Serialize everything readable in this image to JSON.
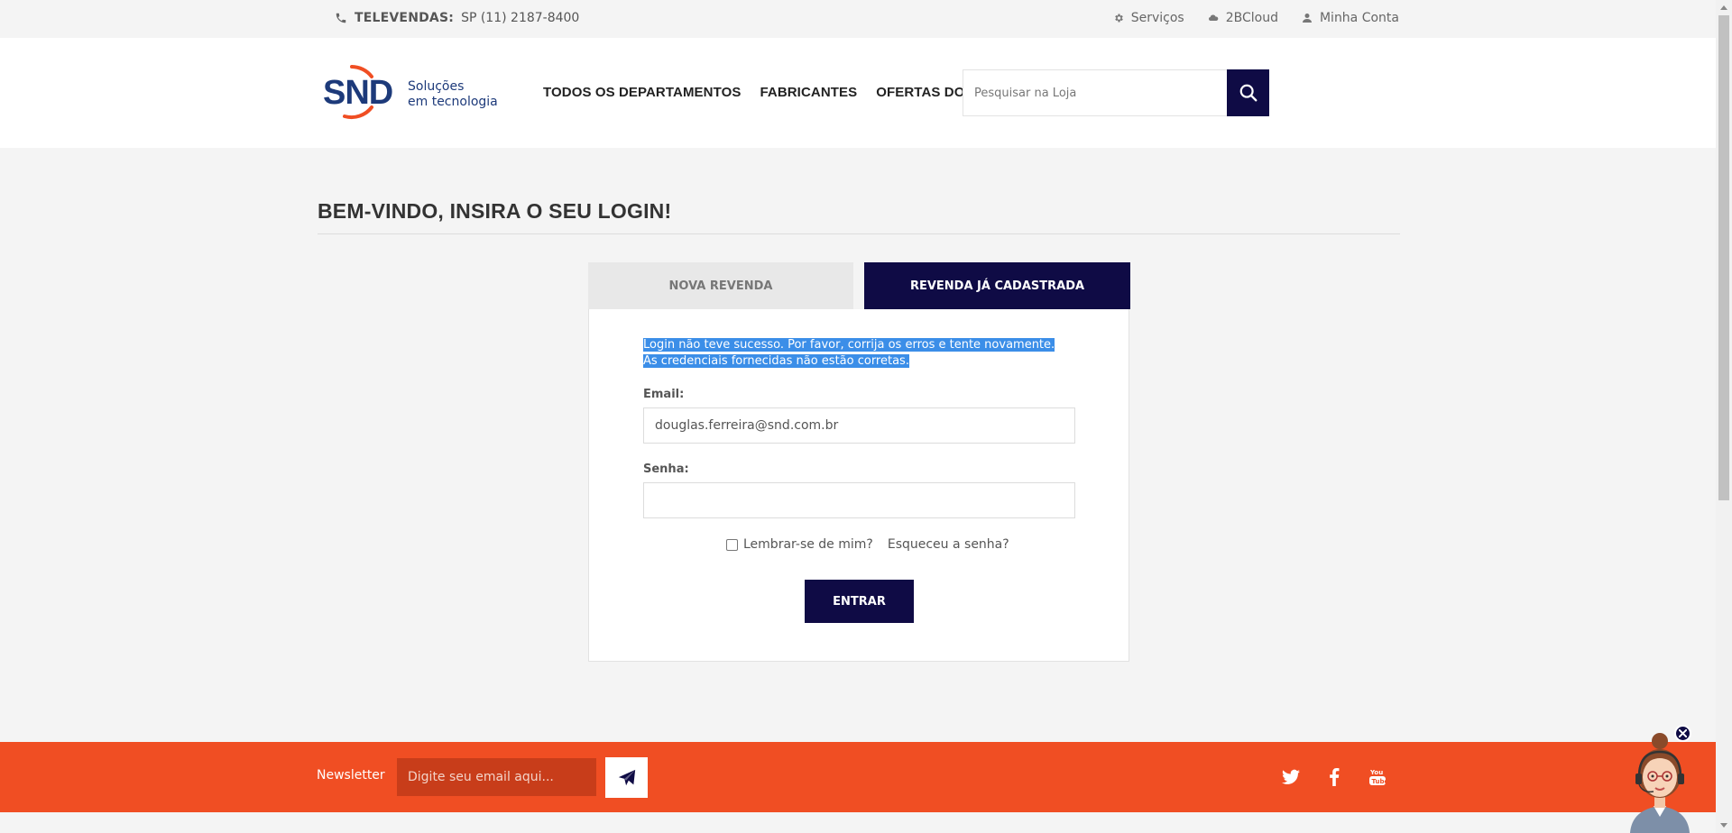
{
  "topbar": {
    "sales_label": "TELEVENDAS:",
    "sales_phone": "SP (11)  2187-8400",
    "links": [
      {
        "label": "Serviços",
        "icon": "gear-icon"
      },
      {
        "label": "2BCloud",
        "icon": "cloud-icon"
      },
      {
        "label": "Minha Conta",
        "icon": "user-icon"
      }
    ]
  },
  "header": {
    "logo": {
      "mark": "SND",
      "tagline_1": "Soluções",
      "tagline_2": "em tecnologia"
    },
    "nav": [
      "TODOS OS DEPARTAMENTOS",
      "FABRICANTES",
      "OFERTAS DO DIA"
    ],
    "search_placeholder": "Pesquisar na Loja"
  },
  "main": {
    "title": "BEM-VINDO, INSIRA O SEU LOGIN!",
    "tabs": [
      {
        "label": "NOVA REVENDA",
        "active": false
      },
      {
        "label": "REVENDA JÁ CADASTRADA",
        "active": true
      }
    ],
    "error_line_1": "Login não teve sucesso. Por favor, corrija os erros e tente novamente.",
    "error_line_2": "As credenciais fornecidas não estão corretas.",
    "email_label": "Email:",
    "email_value": "douglas.ferreira@snd.com.br",
    "password_label": "Senha:",
    "password_value": "",
    "remember_label": "Lembrar-se de mim?",
    "remember_checked": false,
    "forgot_label": "Esqueceu a senha?",
    "submit_label": "ENTRAR"
  },
  "footer": {
    "newsletter_label": "Newsletter",
    "newsletter_placeholder": "Digite seu email aqui...",
    "social": [
      "twitter-icon",
      "facebook-icon",
      "youtube-icon"
    ]
  },
  "colors": {
    "navy": "#0f0b45",
    "orange": "#f04e23",
    "logo_blue": "#1d3a7a",
    "logo_orange": "#f04e23",
    "selection": "#3b8ee8"
  }
}
